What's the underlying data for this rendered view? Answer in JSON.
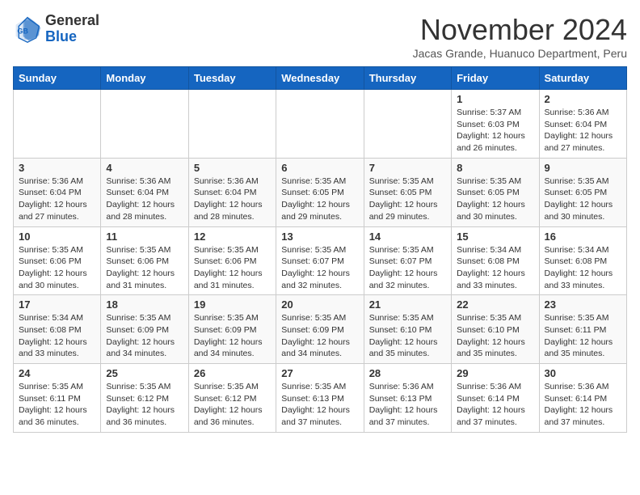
{
  "header": {
    "logo_general": "General",
    "logo_blue": "Blue",
    "month_title": "November 2024",
    "subtitle": "Jacas Grande, Huanuco Department, Peru"
  },
  "weekdays": [
    "Sunday",
    "Monday",
    "Tuesday",
    "Wednesday",
    "Thursday",
    "Friday",
    "Saturday"
  ],
  "weeks": [
    [
      {
        "day": "",
        "info": ""
      },
      {
        "day": "",
        "info": ""
      },
      {
        "day": "",
        "info": ""
      },
      {
        "day": "",
        "info": ""
      },
      {
        "day": "",
        "info": ""
      },
      {
        "day": "1",
        "info": "Sunrise: 5:37 AM\nSunset: 6:03 PM\nDaylight: 12 hours\nand 26 minutes."
      },
      {
        "day": "2",
        "info": "Sunrise: 5:36 AM\nSunset: 6:04 PM\nDaylight: 12 hours\nand 27 minutes."
      }
    ],
    [
      {
        "day": "3",
        "info": "Sunrise: 5:36 AM\nSunset: 6:04 PM\nDaylight: 12 hours\nand 27 minutes."
      },
      {
        "day": "4",
        "info": "Sunrise: 5:36 AM\nSunset: 6:04 PM\nDaylight: 12 hours\nand 28 minutes."
      },
      {
        "day": "5",
        "info": "Sunrise: 5:36 AM\nSunset: 6:04 PM\nDaylight: 12 hours\nand 28 minutes."
      },
      {
        "day": "6",
        "info": "Sunrise: 5:35 AM\nSunset: 6:05 PM\nDaylight: 12 hours\nand 29 minutes."
      },
      {
        "day": "7",
        "info": "Sunrise: 5:35 AM\nSunset: 6:05 PM\nDaylight: 12 hours\nand 29 minutes."
      },
      {
        "day": "8",
        "info": "Sunrise: 5:35 AM\nSunset: 6:05 PM\nDaylight: 12 hours\nand 30 minutes."
      },
      {
        "day": "9",
        "info": "Sunrise: 5:35 AM\nSunset: 6:05 PM\nDaylight: 12 hours\nand 30 minutes."
      }
    ],
    [
      {
        "day": "10",
        "info": "Sunrise: 5:35 AM\nSunset: 6:06 PM\nDaylight: 12 hours\nand 30 minutes."
      },
      {
        "day": "11",
        "info": "Sunrise: 5:35 AM\nSunset: 6:06 PM\nDaylight: 12 hours\nand 31 minutes."
      },
      {
        "day": "12",
        "info": "Sunrise: 5:35 AM\nSunset: 6:06 PM\nDaylight: 12 hours\nand 31 minutes."
      },
      {
        "day": "13",
        "info": "Sunrise: 5:35 AM\nSunset: 6:07 PM\nDaylight: 12 hours\nand 32 minutes."
      },
      {
        "day": "14",
        "info": "Sunrise: 5:35 AM\nSunset: 6:07 PM\nDaylight: 12 hours\nand 32 minutes."
      },
      {
        "day": "15",
        "info": "Sunrise: 5:34 AM\nSunset: 6:08 PM\nDaylight: 12 hours\nand 33 minutes."
      },
      {
        "day": "16",
        "info": "Sunrise: 5:34 AM\nSunset: 6:08 PM\nDaylight: 12 hours\nand 33 minutes."
      }
    ],
    [
      {
        "day": "17",
        "info": "Sunrise: 5:34 AM\nSunset: 6:08 PM\nDaylight: 12 hours\nand 33 minutes."
      },
      {
        "day": "18",
        "info": "Sunrise: 5:35 AM\nSunset: 6:09 PM\nDaylight: 12 hours\nand 34 minutes."
      },
      {
        "day": "19",
        "info": "Sunrise: 5:35 AM\nSunset: 6:09 PM\nDaylight: 12 hours\nand 34 minutes."
      },
      {
        "day": "20",
        "info": "Sunrise: 5:35 AM\nSunset: 6:09 PM\nDaylight: 12 hours\nand 34 minutes."
      },
      {
        "day": "21",
        "info": "Sunrise: 5:35 AM\nSunset: 6:10 PM\nDaylight: 12 hours\nand 35 minutes."
      },
      {
        "day": "22",
        "info": "Sunrise: 5:35 AM\nSunset: 6:10 PM\nDaylight: 12 hours\nand 35 minutes."
      },
      {
        "day": "23",
        "info": "Sunrise: 5:35 AM\nSunset: 6:11 PM\nDaylight: 12 hours\nand 35 minutes."
      }
    ],
    [
      {
        "day": "24",
        "info": "Sunrise: 5:35 AM\nSunset: 6:11 PM\nDaylight: 12 hours\nand 36 minutes."
      },
      {
        "day": "25",
        "info": "Sunrise: 5:35 AM\nSunset: 6:12 PM\nDaylight: 12 hours\nand 36 minutes."
      },
      {
        "day": "26",
        "info": "Sunrise: 5:35 AM\nSunset: 6:12 PM\nDaylight: 12 hours\nand 36 minutes."
      },
      {
        "day": "27",
        "info": "Sunrise: 5:35 AM\nSunset: 6:13 PM\nDaylight: 12 hours\nand 37 minutes."
      },
      {
        "day": "28",
        "info": "Sunrise: 5:36 AM\nSunset: 6:13 PM\nDaylight: 12 hours\nand 37 minutes."
      },
      {
        "day": "29",
        "info": "Sunrise: 5:36 AM\nSunset: 6:14 PM\nDaylight: 12 hours\nand 37 minutes."
      },
      {
        "day": "30",
        "info": "Sunrise: 5:36 AM\nSunset: 6:14 PM\nDaylight: 12 hours\nand 37 minutes."
      }
    ]
  ]
}
